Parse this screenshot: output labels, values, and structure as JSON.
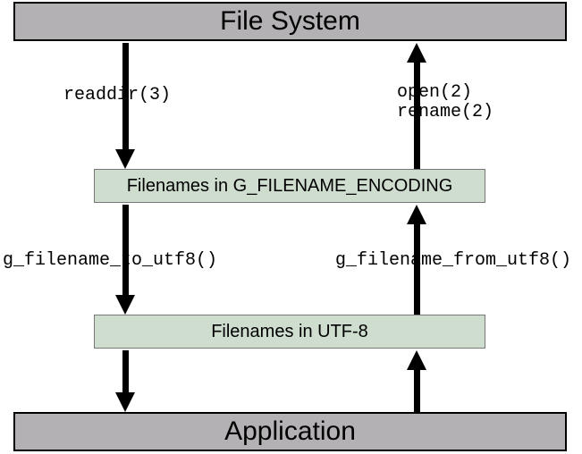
{
  "top_box": "File System",
  "bottom_box": "Application",
  "middle_box_1": "Filenames in G_FILENAME_ENCODING",
  "middle_box_2": "Filenames in UTF-8",
  "labels": {
    "readdir": "readdir(3)",
    "open": "open(2)",
    "rename": "rename(2)",
    "to_utf8": "g_filename_to_utf8()",
    "from_utf8": "g_filename_from_utf8()"
  }
}
